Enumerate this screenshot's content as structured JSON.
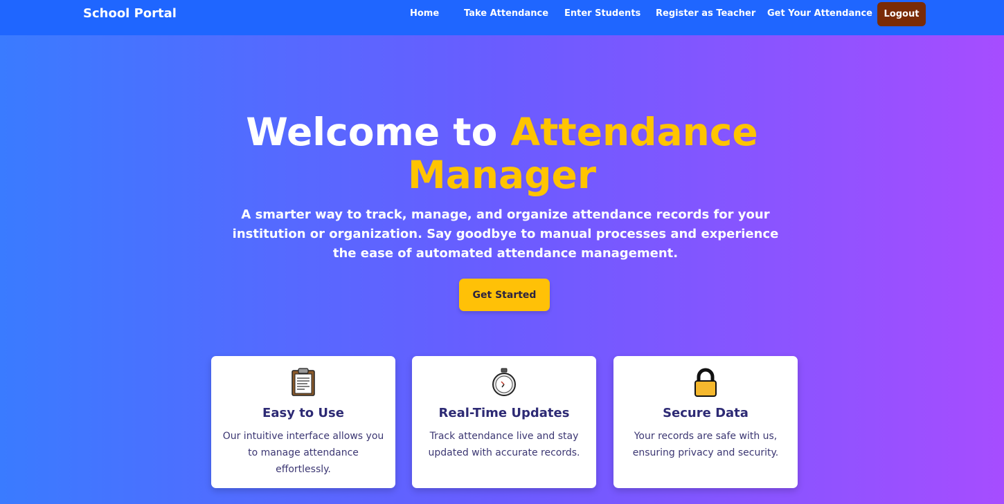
{
  "nav": {
    "brand": "School Portal",
    "links": [
      "Home",
      "Take Attendance",
      "Enter Students",
      "Register as Teacher",
      "Get Your Attendance"
    ],
    "logout": "Logout"
  },
  "hero": {
    "title_prefix": "Welcome to",
    "title_accent_1": "Attendance",
    "title_accent_2": "Manager",
    "subtitle": "A smarter way to track, manage, and organize attendance records for your institution or organization. Say goodbye to manual processes and experience the ease of automated attendance management.",
    "cta": "Get Started"
  },
  "features": [
    {
      "icon": "clipboard-icon",
      "title": "Easy to Use",
      "text": "Our intuitive interface allows you to manage attendance effortlessly."
    },
    {
      "icon": "stopwatch-icon",
      "title": "Real-Time Updates",
      "text": "Track attendance live and stay updated with accurate records."
    },
    {
      "icon": "lock-icon",
      "title": "Secure Data",
      "text": "Your records are safe with us, ensuring privacy and security."
    }
  ],
  "colors": {
    "nav_bg": "#1f66ff",
    "accent": "#ffc400",
    "logout_bg": "#7a2b06",
    "card_title": "#2d2a74"
  }
}
